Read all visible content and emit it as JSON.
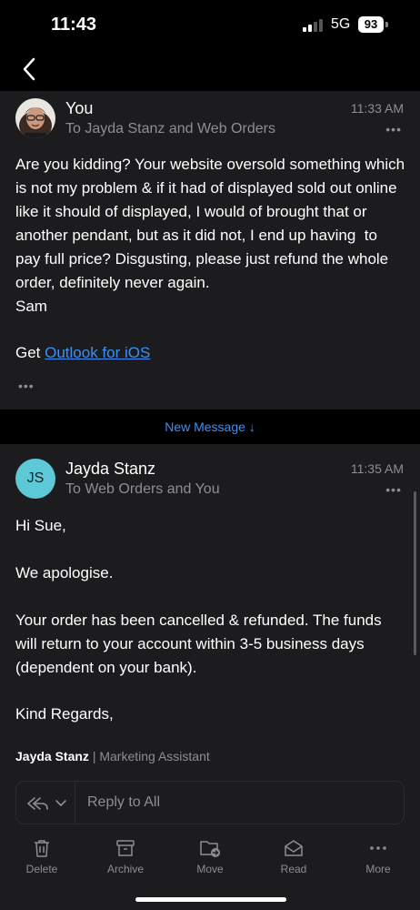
{
  "status_bar": {
    "time": "11:43",
    "network": "5G",
    "battery": "93"
  },
  "nav": {
    "back_icon": "chevron-left-icon"
  },
  "thread": {
    "messages": [
      {
        "sender": "You",
        "recipients": "To Jayda Stanz and Web Orders",
        "time": "11:33 AM",
        "body": "Are you kidding? Your website oversold something which is not my problem & if it had of displayed sold out online like it should of displayed, I would of brought that or another pendant, but as it did not, I end up having  to pay full price? Disgusting, please just refund the whole order, definitely never again.\nSam",
        "footer_prefix": "Get ",
        "footer_link": "Outlook for iOS",
        "expand": "•••"
      },
      {
        "sender": "Jayda Stanz",
        "initials": "JS",
        "recipients": "To Web Orders and You",
        "time": "11:35 AM",
        "greeting": "Hi Sue,",
        "line1": "We apologise.",
        "line2": "Your order has been cancelled & refunded. The funds will return to your account within 3-5 business days (dependent on your bank).",
        "closing": "Kind Regards,",
        "signature_name": "Jayda Stanz",
        "signature_sep": " | ",
        "signature_title": "Marketing Assistant",
        "avatar_color": "#5ec9d6"
      }
    ],
    "new_message_label": "New Message ↓",
    "more_dots": "•••"
  },
  "reply": {
    "placeholder": "Reply to All"
  },
  "toolbar": {
    "items": [
      {
        "label": "Delete",
        "icon": "trash-icon"
      },
      {
        "label": "Archive",
        "icon": "archive-icon"
      },
      {
        "label": "Move",
        "icon": "folder-move-icon"
      },
      {
        "label": "Read",
        "icon": "envelope-open-icon"
      },
      {
        "label": "More",
        "icon": "more-dots-icon"
      }
    ]
  },
  "colors": {
    "accent": "#3d8ff5",
    "background": "#1c1c1e",
    "muted": "#8e8e93"
  }
}
